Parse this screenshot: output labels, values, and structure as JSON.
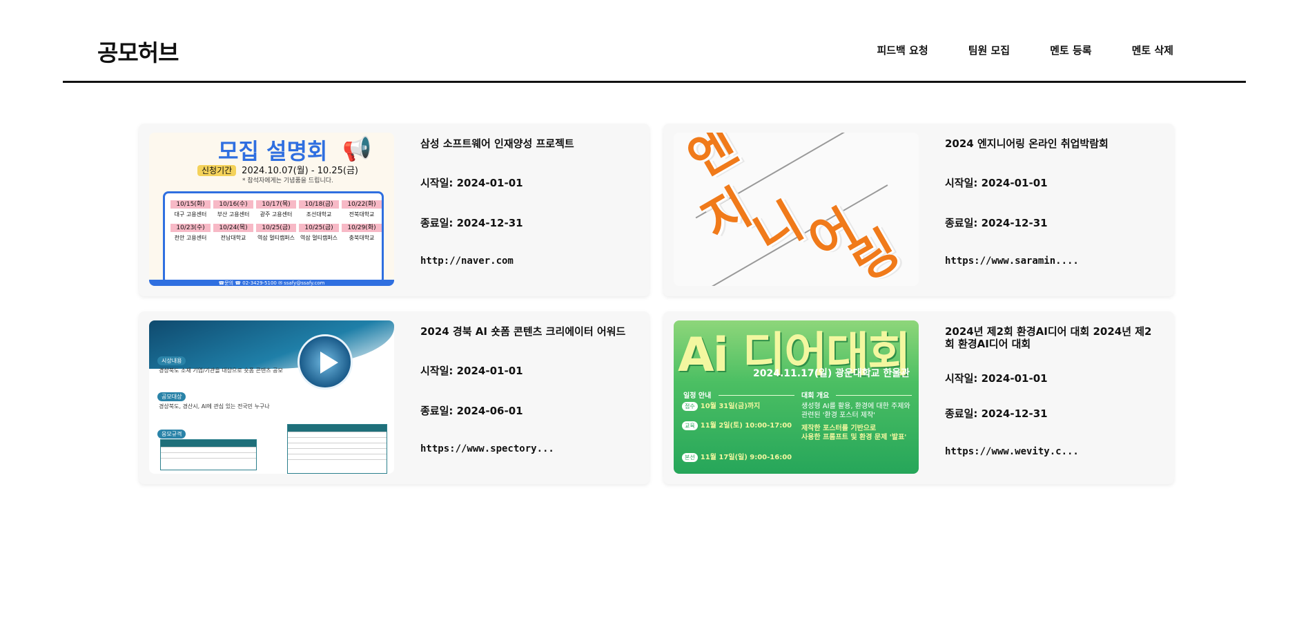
{
  "header": {
    "logo": "공모허브",
    "nav": [
      "피드백 요청",
      "팀원 모집",
      "멘토 등록",
      "멘토 삭제"
    ]
  },
  "cards": [
    {
      "title": "삼성 소프트웨어 인재양성 프로젝트",
      "start": "시작일: 2024-01-01",
      "end": "종료일: 2024-12-31",
      "link": "http://naver.com",
      "thumb": {
        "heading": "모집 설명회",
        "chip": "신청기간",
        "period": "2024.10.07(월) - 10.25(금)",
        "note": "* 참석자에게는 기념품을 드립니다.",
        "cells": [
          {
            "date": "10/15(화)",
            "place": "대구 고용센터"
          },
          {
            "date": "10/16(수)",
            "place": "부산 고용센터"
          },
          {
            "date": "10/17(목)",
            "place": "광주 고용센터"
          },
          {
            "date": "10/18(금)",
            "place": "조선대학교"
          },
          {
            "date": "10/22(화)",
            "place": "전북대학교"
          },
          {
            "date": "10/23(수)",
            "place": "천안 고용센터"
          },
          {
            "date": "10/24(목)",
            "place": "전남대학교"
          },
          {
            "date": "10/25(금)",
            "place": "역삼 멀티캠퍼스"
          },
          {
            "date": "10/25(금)",
            "place": "역삼 멀티캠퍼스"
          },
          {
            "date": "10/29(화)",
            "place": "충북대학교"
          }
        ],
        "footer": "☎문의   ☎ 02-3429-5100   ✉ ssafy@ssafy.com"
      }
    },
    {
      "title": "2024 엔지니어링 온라인 취업박람회",
      "start": "시작일: 2024-01-01",
      "end": "종료일: 2024-12-31",
      "link": "https://www.saramin....",
      "thumb": {
        "chars": [
          "엔",
          "지",
          "니",
          "어",
          "링"
        ]
      }
    },
    {
      "title": "2024 경북 AI 숏폼 콘텐츠 크리에이터 어워드",
      "start": "시작일: 2024-01-01",
      "end": "종료일: 2024-06-01",
      "link": "https://www.spectory...",
      "thumb": {
        "tags": [
          "시상내용",
          "공모대상",
          "응모규격"
        ],
        "lines": [
          "경상북도 소재 기업/기관을 대상으로 숏폼 콘텐츠 공모",
          "경상북도, 경산시, AI에 관심 있는 전국민 누구나"
        ]
      }
    },
    {
      "title": "2024년 제2회 환경AI디어 대회 2024년 제2회 환경AI디어 대회",
      "start": "시작일: 2024-01-01",
      "end": "종료일: 2024-12-31",
      "link": "https://www.wevity.c...",
      "thumb": {
        "heading": "Ai 디어대회",
        "sub": "2024.11.17(일)  광운대학교 한울관",
        "sec1": "일정 안내",
        "sec2": "대회 개요",
        "s1": "10월 31일(금)까지",
        "s2": "11월 2일(토) 10:00-17:00",
        "s3": "11월 17일(일) 9:00-16:00",
        "p1": "접수",
        "p2": "교육",
        "p3": "본선",
        "o1": "생성형 AI를 활용, 환경에 대한 주제와",
        "o2": "관련된 '환경 포스터 제작'",
        "o3": "제작한 포스터를 기반으로",
        "o4": "사용한 프롬프트 및 환경 문제 '발표'"
      }
    }
  ]
}
